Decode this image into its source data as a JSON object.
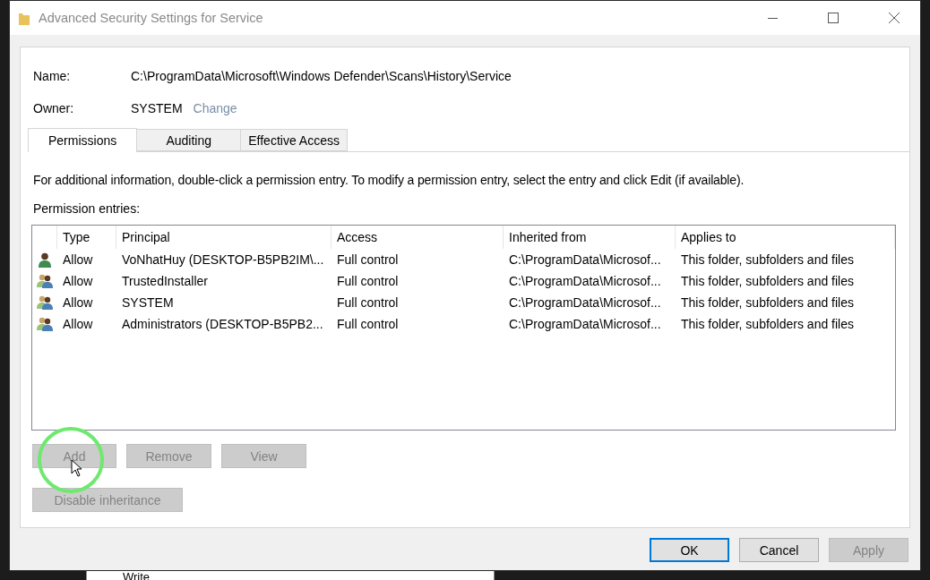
{
  "background": {
    "dropdown_value": "Write"
  },
  "window": {
    "title": "Advanced Security Settings for Service"
  },
  "name": {
    "label": "Name:",
    "value": "C:\\ProgramData\\Microsoft\\Windows Defender\\Scans\\History\\Service"
  },
  "owner": {
    "label": "Owner:",
    "value": "SYSTEM",
    "change_link": "Change"
  },
  "tabs": [
    {
      "label": "Permissions",
      "selected": true
    },
    {
      "label": "Auditing",
      "selected": false
    },
    {
      "label": "Effective Access",
      "selected": false
    }
  ],
  "description": "For additional information, double-click a permission entry. To modify a permission entry, select the entry and click Edit (if available).",
  "entries_label": "Permission entries:",
  "table": {
    "columns": [
      "Type",
      "Principal",
      "Access",
      "Inherited from",
      "Applies to"
    ],
    "rows": [
      {
        "kind": "user",
        "cells": [
          "Allow",
          "VoNhatHuy (DESKTOP-B5PB2IM\\...",
          "Full control",
          "C:\\ProgramData\\Microsof...",
          "This folder, subfolders and files"
        ]
      },
      {
        "kind": "group",
        "cells": [
          "Allow",
          "TrustedInstaller",
          "Full control",
          "C:\\ProgramData\\Microsof...",
          "This folder, subfolders and files"
        ]
      },
      {
        "kind": "group",
        "cells": [
          "Allow",
          "SYSTEM",
          "Full control",
          "C:\\ProgramData\\Microsof...",
          "This folder, subfolders and files"
        ]
      },
      {
        "kind": "group",
        "cells": [
          "Allow",
          "Administrators (DESKTOP-B5PB2...",
          "Full control",
          "C:\\ProgramData\\Microsof...",
          "This folder, subfolders and files"
        ]
      }
    ]
  },
  "entry_buttons": [
    {
      "label": "Add",
      "disabled": true
    },
    {
      "label": "Remove",
      "disabled": true
    },
    {
      "label": "View",
      "disabled": true
    }
  ],
  "inheritance_button": {
    "label": "Disable inheritance",
    "disabled": true
  },
  "dialog_buttons": [
    {
      "label": "OK",
      "disabled": false,
      "default": true
    },
    {
      "label": "Cancel",
      "disabled": false,
      "default": false
    },
    {
      "label": "Apply",
      "disabled": true,
      "default": false
    }
  ]
}
